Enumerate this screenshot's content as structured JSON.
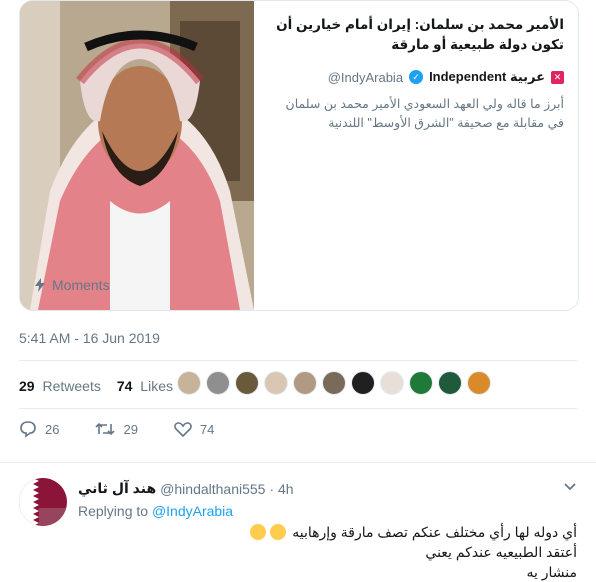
{
  "card": {
    "headline": "الأمير محمد بن سلمان: إيران أمام خيارين أن تكون دولة طبيعية أو مارقة",
    "source_name": "Independent عربية",
    "source_handle": "@IndyArabia",
    "description": "أبرز ما قاله ولي العهد السعودي الأمير محمد بن سلمان في مقابلة مع صحيفة \"الشرق الأوسط\" اللندنية",
    "moments_label": "Moments"
  },
  "tweet": {
    "timestamp": "5:41 AM - 16 Jun 2019",
    "retweets_count": "29",
    "retweets_label": "Retweets",
    "likes_count": "74",
    "likes_label": "Likes",
    "avatar_colors": [
      "#c7b39a",
      "#8f8f8f",
      "#6b5a3a",
      "#d9c7b3",
      "#b09a83",
      "#7a6a5a",
      "#202020",
      "#e8e0d8",
      "#1f7a3a",
      "#1f5a3a",
      "#d98a2a"
    ]
  },
  "actions": {
    "replies": "26",
    "retweets": "29",
    "likes": "74"
  },
  "reply": {
    "name": "هند آل ثاني",
    "handle": "@hindalthani555",
    "time": "· 4h",
    "replying_prefix": "Replying to",
    "replying_to": "@IndyArabia",
    "line1": "أي دوله لها رأي مختلف عنكم تصف مارقة وإرهابيه",
    "line2": "أعتقد الطبيعيه عندكم يعني",
    "line3": "منشار يه"
  },
  "colors": {
    "accent": "#1da1f2",
    "muted": "#657786",
    "qatar_maroon": "#8a1538"
  }
}
